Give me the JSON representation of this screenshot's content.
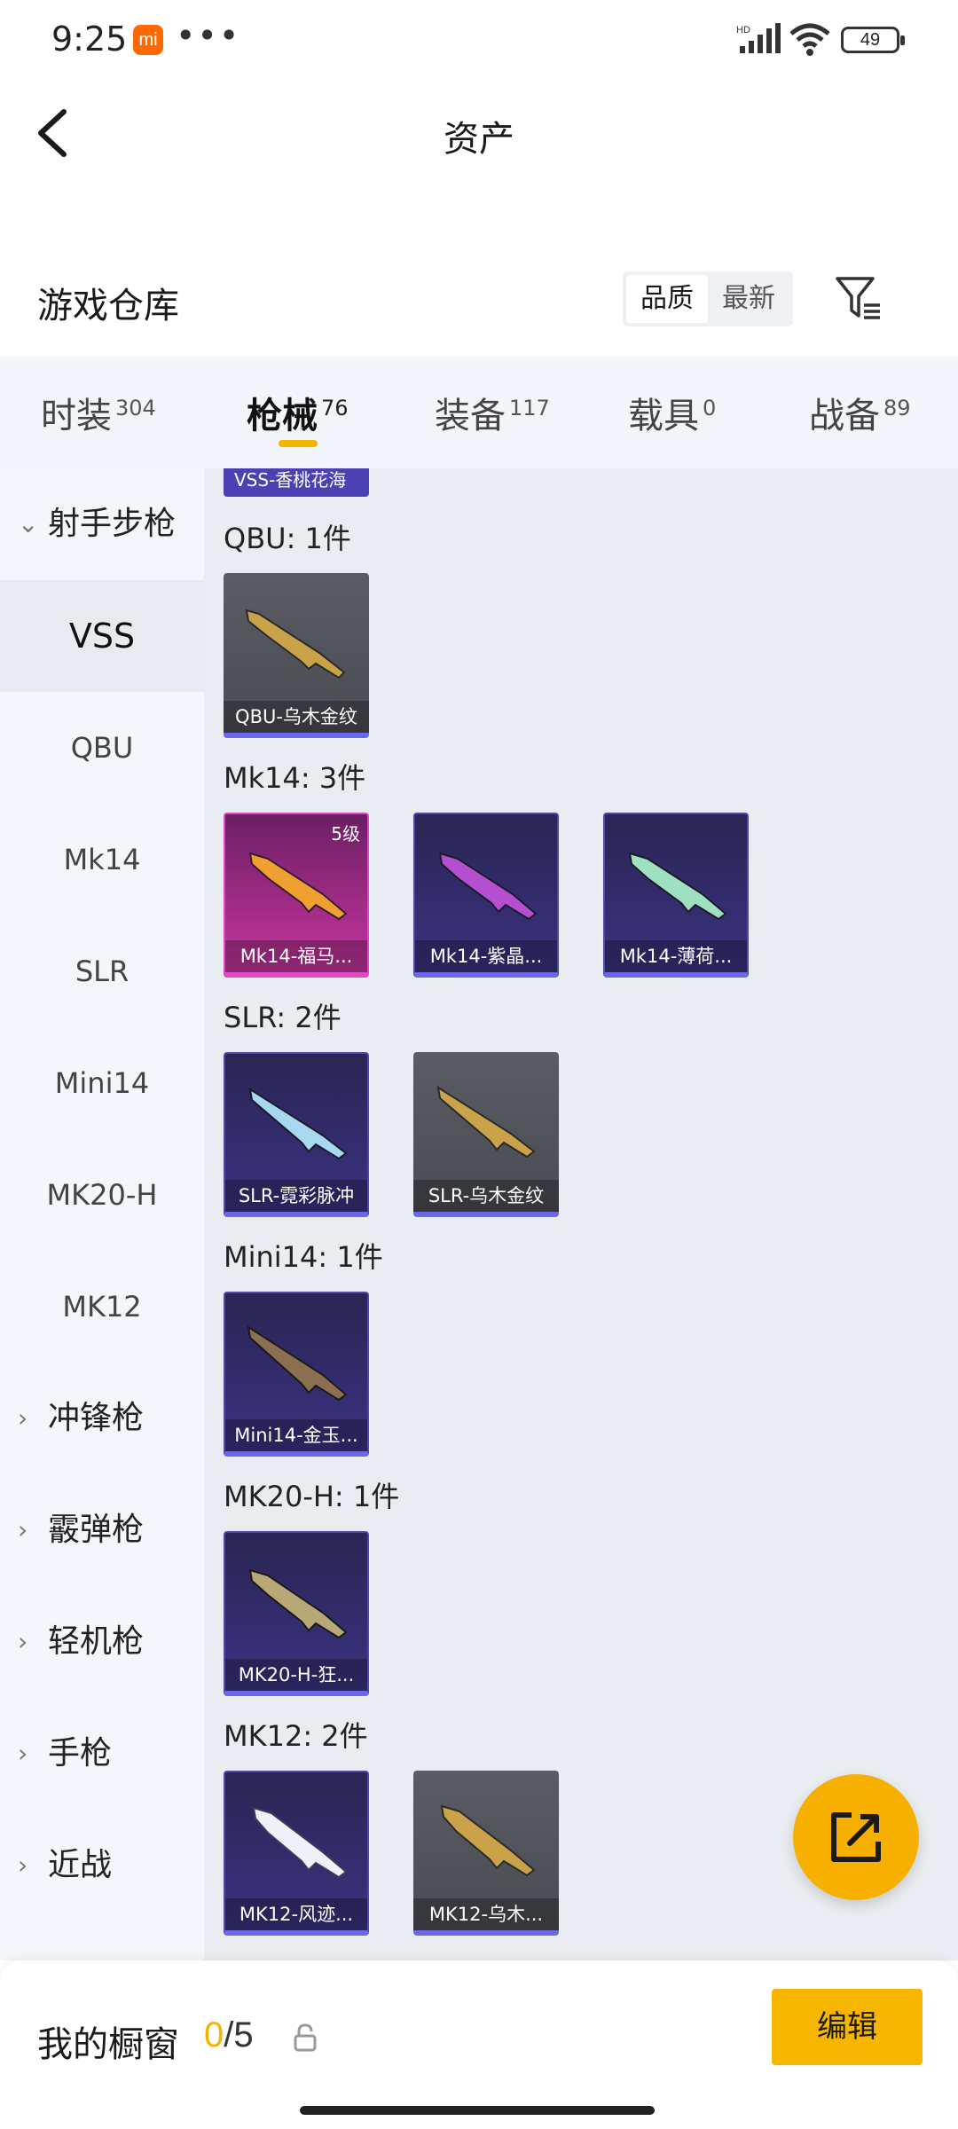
{
  "status_bar": {
    "time": "9:25",
    "app_badge": "mi",
    "dots": "•••",
    "battery": "49",
    "network": "HD"
  },
  "header": {
    "title": "资产"
  },
  "warehouse": {
    "title": "游戏仓库",
    "sort_options": [
      "品质",
      "最新"
    ],
    "active_sort": "品质"
  },
  "tabs": [
    {
      "label": "时装",
      "count": "304"
    },
    {
      "label": "枪械",
      "count": "76",
      "active": true
    },
    {
      "label": "装备",
      "count": "117"
    },
    {
      "label": "载具",
      "count": "0"
    },
    {
      "label": "战备",
      "count": "89"
    }
  ],
  "sidebar": {
    "items": [
      {
        "label": "射手步枪",
        "type": "group-expanded"
      },
      {
        "label": "VSS",
        "active": true
      },
      {
        "label": "QBU"
      },
      {
        "label": "Mk14"
      },
      {
        "label": "SLR"
      },
      {
        "label": "Mini14"
      },
      {
        "label": "MK20-H"
      },
      {
        "label": "MK12"
      },
      {
        "label": "冲锋枪",
        "type": "group"
      },
      {
        "label": "霰弹枪",
        "type": "group"
      },
      {
        "label": "轻机枪",
        "type": "group"
      },
      {
        "label": "手枪",
        "type": "group"
      },
      {
        "label": "近战",
        "type": "group"
      }
    ]
  },
  "content": {
    "partial_card": "VSS-香桃花海",
    "groups": [
      {
        "label": "QBU: 1件",
        "items": [
          {
            "name": "QBU-乌木金纹",
            "style": "gray"
          }
        ]
      },
      {
        "label": "Mk14: 3件",
        "items": [
          {
            "name": "Mk14-福马...",
            "style": "pink",
            "level": "5级"
          },
          {
            "name": "Mk14-紫晶...",
            "style": "purple"
          },
          {
            "name": "Mk14-薄荷...",
            "style": "purple"
          }
        ]
      },
      {
        "label": "SLR: 2件",
        "items": [
          {
            "name": "SLR-霓彩脉冲",
            "style": "purple"
          },
          {
            "name": "SLR-乌木金纹",
            "style": "gray"
          }
        ]
      },
      {
        "label": "Mini14: 1件",
        "items": [
          {
            "name": "Mini14-金玉...",
            "style": "purple"
          }
        ]
      },
      {
        "label": "MK20-H: 1件",
        "items": [
          {
            "name": "MK20-H-狂...",
            "style": "purple"
          }
        ]
      },
      {
        "label": "MK12: 2件",
        "items": [
          {
            "name": "MK12-风迹...",
            "style": "purple"
          },
          {
            "name": "MK12-乌木...",
            "style": "gray"
          }
        ]
      }
    ]
  },
  "bottom": {
    "showcase_label": "我的橱窗",
    "used": "0",
    "separator": "/",
    "total": "5",
    "edit_label": "编辑"
  }
}
